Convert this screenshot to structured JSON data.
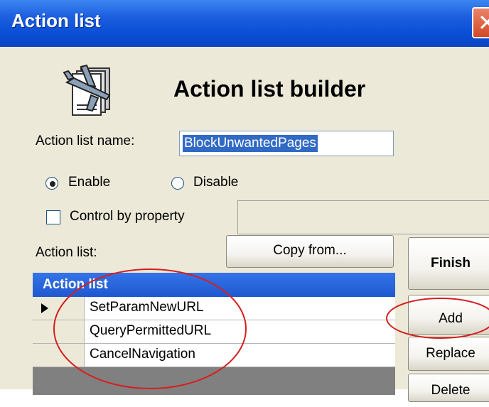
{
  "window": {
    "title": "Action list",
    "close_icon": "close-icon"
  },
  "header": {
    "heading": "Action list builder",
    "icon": "action-list-builder-icon"
  },
  "form": {
    "name_label": "Action list name:",
    "name_value": "BlockUnwantedPages",
    "enable_label": "Enable",
    "disable_label": "Disable",
    "enable_selected": true,
    "control_label": "Control by property",
    "control_checked": false,
    "property_value": ""
  },
  "action_list": {
    "label": "Action list:",
    "copy_from_label": "Copy from...",
    "column_header": "Action list",
    "rows": [
      "SetParamNewURL",
      "QueryPermittedURL",
      "CancelNavigation"
    ],
    "current_row_indicator": "row-pointer-icon"
  },
  "buttons": {
    "finish": "Finish",
    "add": "Add",
    "replace": "Replace",
    "delete": "Delete"
  },
  "colors": {
    "titlebar": "#0a4fd6",
    "dialog_bg": "#ece9d8",
    "selection": "#316ac5",
    "annotation": "#d42020"
  }
}
